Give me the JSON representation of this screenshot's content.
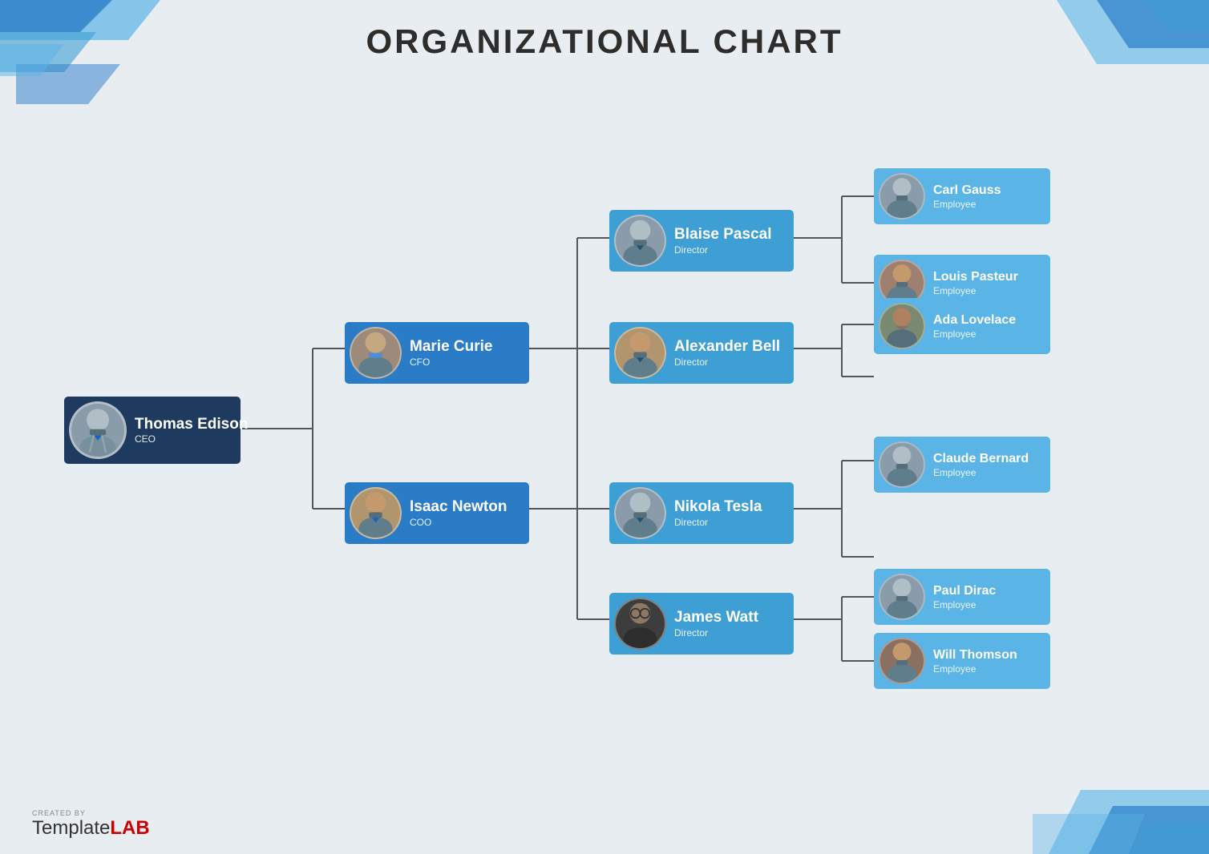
{
  "page": {
    "title": "ORGANIZATIONAL CHART",
    "background": "#e0e5ec"
  },
  "watermark": {
    "created_by": "CREATED BY",
    "brand_plain": "Template",
    "brand_bold": "LAB"
  },
  "nodes": {
    "ceo": {
      "name": "Thomas Edison",
      "role": "CEO"
    },
    "cfo": {
      "name": "Marie Curie",
      "role": "CFO"
    },
    "coo": {
      "name": "Isaac Newton",
      "role": "COO"
    },
    "directors": [
      {
        "name": "Blaise Pascal",
        "role": "Director"
      },
      {
        "name": "Alexander Bell",
        "role": "Director"
      },
      {
        "name": "Nikola Tesla",
        "role": "Director"
      },
      {
        "name": "James Watt",
        "role": "Director"
      }
    ],
    "employees": [
      {
        "name": "Carl Gauss",
        "role": "Employee"
      },
      {
        "name": "Louis Pasteur",
        "role": "Employee"
      },
      {
        "name": "Ada Lovelace",
        "role": "Employee"
      },
      {
        "name": "Claude Bernard",
        "role": "Employee"
      },
      {
        "name": "Paul Dirac",
        "role": "Employee"
      },
      {
        "name": "Will Thomson",
        "role": "Employee"
      }
    ]
  },
  "colors": {
    "ceo_bg": "#1e3a5f",
    "mid_bg": "#2a7cc7",
    "dir_bg": "#3d9fd3",
    "emp_bg": "#5ab4e5",
    "line": "#555",
    "deco_blue": "#2a7cc7",
    "deco_light": "#5ab4e5"
  }
}
